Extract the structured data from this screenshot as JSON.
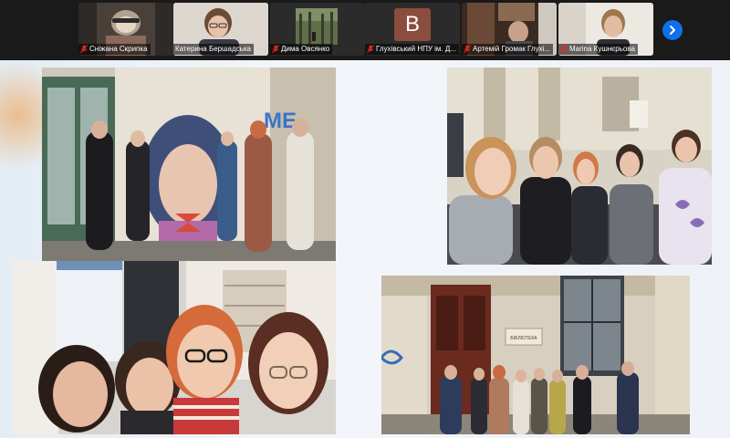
{
  "participants": [
    {
      "name": "Сніжана Скрипка",
      "muted": true
    },
    {
      "name": "Катерина Бершадська",
      "muted": false,
      "active": true
    },
    {
      "name": "Дима Овсянко",
      "muted": true
    },
    {
      "name": "Глухівський НПУ ім. Д...",
      "muted": true,
      "avatar_letter": "B"
    },
    {
      "name": "Артемій Громак Глухі...",
      "muted": true
    },
    {
      "name": "Marina Кушнєрьова",
      "muted": true
    }
  ],
  "icons": {
    "mic_muted": "mic-muted-icon",
    "next": "chevron-right-icon"
  },
  "colors": {
    "strip_bg": "#1a1a1a",
    "active_outline": "#2ecc71",
    "next_button": "#0e71eb",
    "muted_mic": "#e02828",
    "avatar_bg": "#8b4d3d"
  },
  "shared_screen": {
    "photos": [
      {
        "subject": "group-in-front-of-mural",
        "mural_text": "ME"
      },
      {
        "subject": "group-selfie-courtyard"
      },
      {
        "subject": "four-person-selfie"
      },
      {
        "subject": "group-in-front-of-library-entrance",
        "sign_text": "БІБЛІОТЕКА"
      }
    ]
  }
}
